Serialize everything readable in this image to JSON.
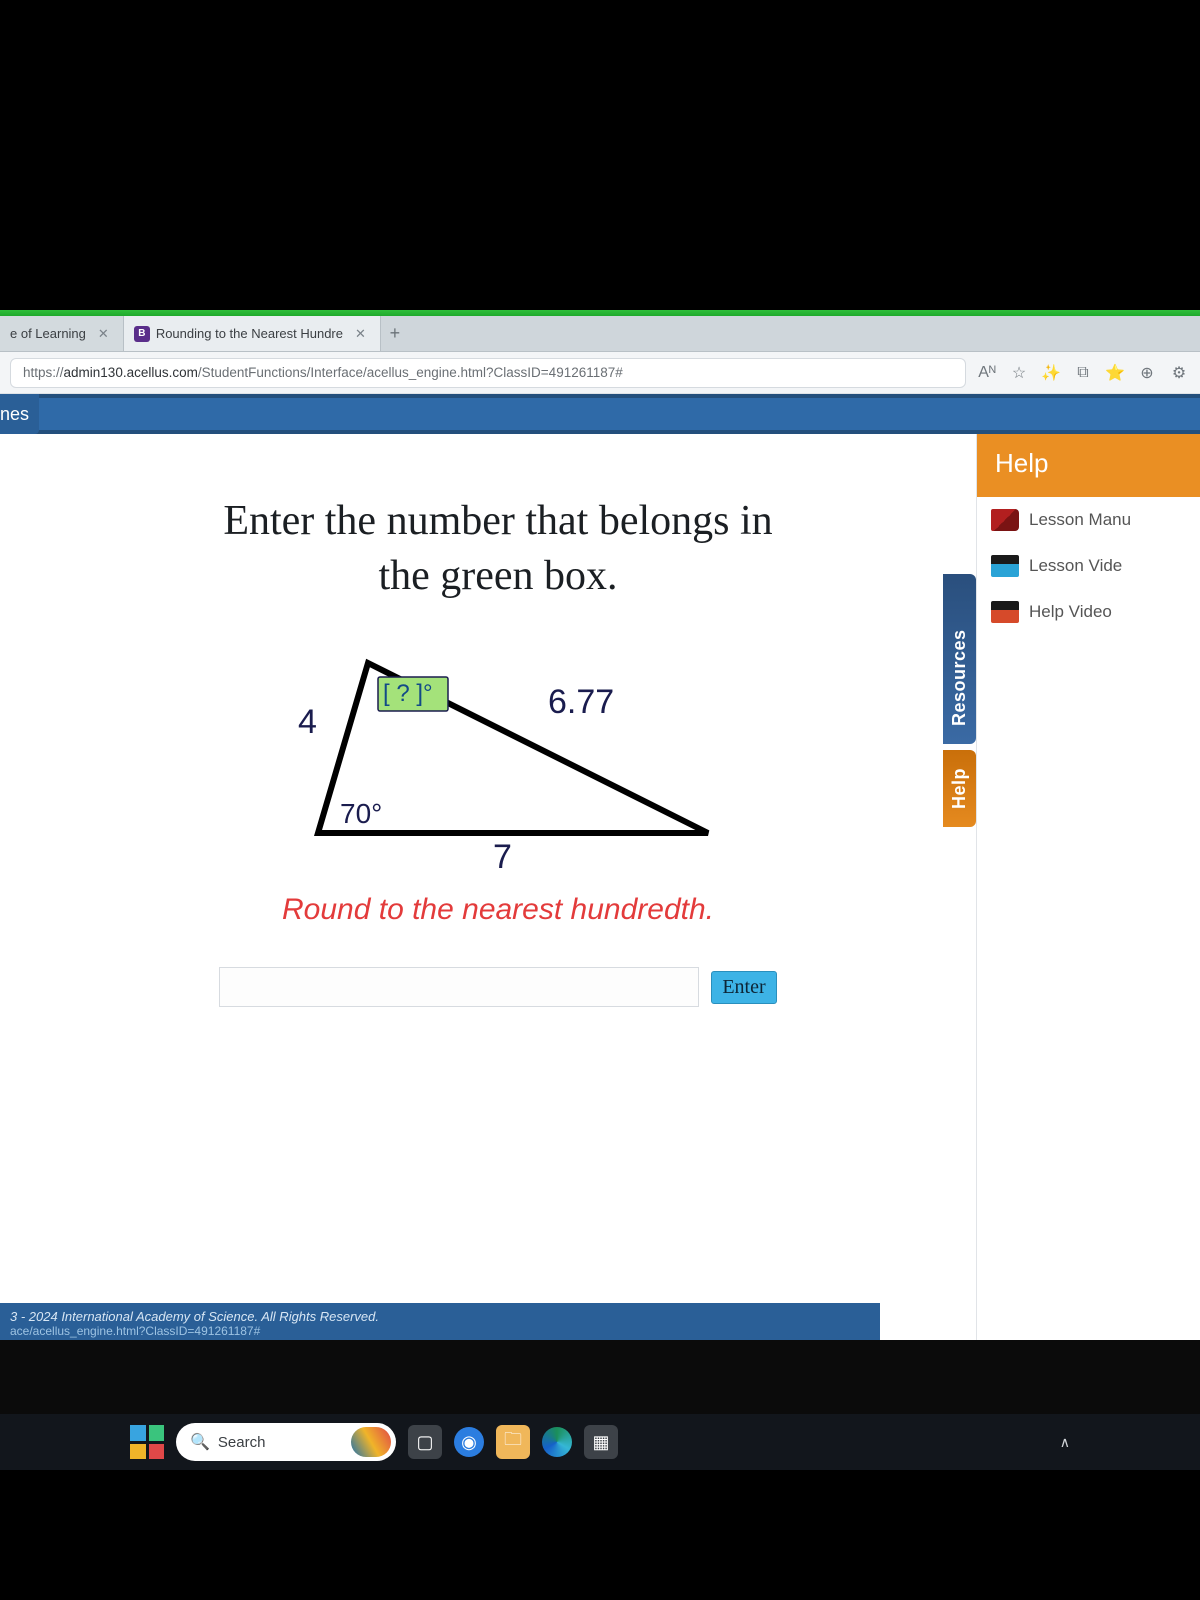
{
  "browser": {
    "tabs": [
      {
        "title": "e of Learning",
        "active": false
      },
      {
        "title": "Rounding to the Nearest Hundre",
        "active": true
      }
    ],
    "url_prefix": "https://",
    "url_host": "admin130.acellus.com",
    "url_path": "/StudentFunctions/Interface/acellus_engine.html?ClassID=491261187#",
    "toolbar_icons": [
      "Aᴺ",
      "☆",
      "✨",
      "⧉",
      "⭐",
      "⊕",
      "⚙"
    ]
  },
  "site": {
    "left_fragment": "nes"
  },
  "question": {
    "prompt_line1": "Enter the number that belongs in",
    "prompt_line2": "the green box.",
    "instruction": "Round to the nearest hundredth.",
    "enter_label": "Enter",
    "answer_value": ""
  },
  "triangle": {
    "side_left": "4",
    "side_bottom": "7",
    "side_hyp": "6.77",
    "angle_bottom_left": "70°",
    "unknown_label": "[ ? ]°"
  },
  "help": {
    "tab_help": "Help",
    "tab_resources": "Resources",
    "panel_title": "Help",
    "items": [
      "Lesson Manu",
      "Lesson Vide",
      "Help Video"
    ]
  },
  "footer": {
    "copyright": "3 - 2024 International Academy of Science. All Rights Reserved.",
    "path": "ace/acellus_engine.html?ClassID=491261187#"
  },
  "taskbar": {
    "search_placeholder": "Search",
    "tray_caret": "∧"
  }
}
